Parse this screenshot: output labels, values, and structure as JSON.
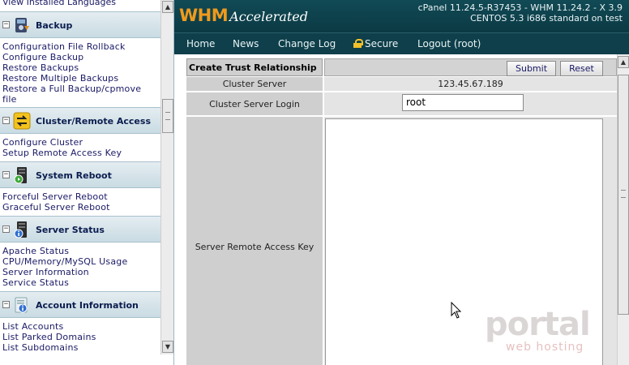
{
  "sidebar": {
    "top_link": "View Installed Languages",
    "sections": [
      {
        "title": "Backup",
        "icon": "backup-icon",
        "links": [
          "Configuration File Rollback",
          "Configure Backup",
          "Restore Backups",
          "Restore Multiple Backups",
          "Restore a Full Backup/cpmove",
          "file"
        ]
      },
      {
        "title": "Cluster/Remote Access",
        "icon": "cluster-arrows-icon",
        "links": [
          "Configure Cluster",
          "Setup Remote Access Key"
        ]
      },
      {
        "title": "System Reboot",
        "icon": "server-reboot-icon",
        "links": [
          "Forceful Server Reboot",
          "Graceful Server Reboot"
        ]
      },
      {
        "title": "Server Status",
        "icon": "server-info-icon",
        "links": [
          "Apache Status",
          "CPU/Memory/MySQL Usage",
          "Server Information",
          "Service Status"
        ]
      },
      {
        "title": "Account Information",
        "icon": "account-info-icon",
        "links": [
          "List Accounts",
          "List Parked Domains",
          "List Subdomains"
        ]
      }
    ]
  },
  "banner": {
    "logo_main": "WHM",
    "logo_sub": "Accelerated",
    "version_line1": "cPanel 11.24.5-R37453 - WHM 11.24.2 - X 3.9",
    "version_line2": "CENTOS 5.3 i686 standard on test"
  },
  "nav": {
    "items": [
      "Home",
      "News",
      "Change Log",
      "Secure",
      "Logout (root)"
    ]
  },
  "form": {
    "title": "Create Trust Relationship",
    "submit_label": "Submit",
    "reset_label": "Reset",
    "cluster_server_label": "Cluster Server",
    "cluster_server_value": "123.45.67.189",
    "login_label": "Cluster Server Login",
    "login_value": "root",
    "remote_key_label": "Server Remote Access Key",
    "remote_key_value": ""
  },
  "watermark": {
    "logo": "portal",
    "sub": "web hosting"
  },
  "colors": {
    "banner_bg": "#0b3a44",
    "logo_orange": "#f09a1c",
    "secure_lock": "#f2c02a",
    "sidebar_link": "#1a1a66"
  }
}
